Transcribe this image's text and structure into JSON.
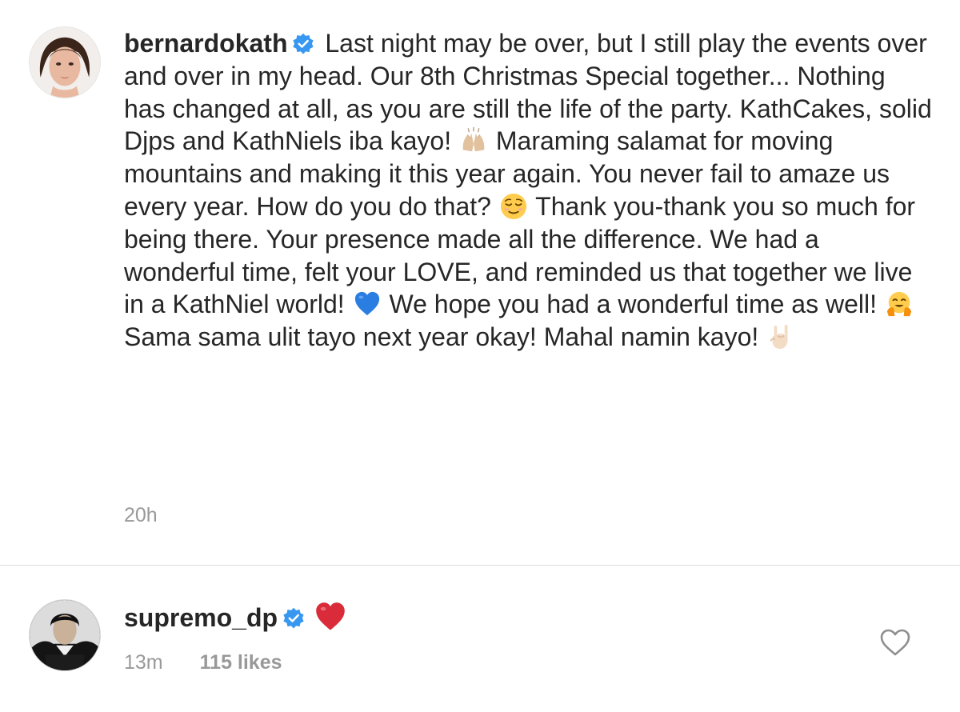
{
  "caption": {
    "username": "bernardokath",
    "segments": [
      "Last night may be over, but I still play the events over and over in my head.  Our 8th Christmas Special together... Nothing has changed at all, as you are still the life of the party.  KathCakes, solid Djps and KathNiels iba kayo!",
      "Maraming salamat for moving mountains and making it this year again.  You never fail to amaze us every year.  How do you do that?",
      "Thank you-thank you so much for being there. Your presence made all the difference. We had a wonderful time, felt your LOVE, and reminded us that together we live in a KathNiel world!",
      "We hope you had a wonderful time as well!",
      "Sama sama ulit tayo next year okay! Mahal namin kayo!"
    ],
    "emojis": [
      "raising-hands-emoji",
      "relieved-face-emoji",
      "blue-heart-emoji",
      "hugging-face-emoji",
      "rock-on-hand-emoji"
    ],
    "time": "20h"
  },
  "comment": {
    "username": "supremo_dp",
    "emoji": "red-heart-emoji",
    "time": "13m",
    "likes": "115 likes"
  },
  "icons": {
    "verified": "verified-badge-icon",
    "like": "heart-outline-icon"
  },
  "colors": {
    "verified_blue": "#3897f0",
    "text": "#262626",
    "meta_gray": "#999999",
    "divider": "#dbdbdb",
    "red_heart": "#d92b3a",
    "blue_heart": "#2a7de1"
  }
}
